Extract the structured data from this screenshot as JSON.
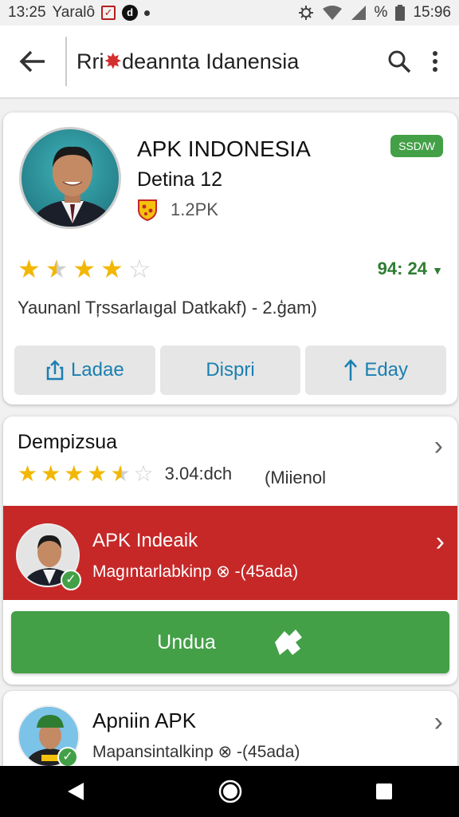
{
  "status_bar": {
    "time_left": "13:25",
    "left_text": "Yaralô",
    "time_right": "15:96",
    "percent": "%"
  },
  "app_bar": {
    "title_pre": "Rri",
    "title_post": "deannta Idanensia"
  },
  "app_card": {
    "name": "APK INDONESIA",
    "subtitle": "Detina 12",
    "badge": "SSD/W",
    "size": "1.2PK",
    "rating_stars": 3.5,
    "score": "94: 24",
    "description": "Yaunanl Tŗssarlaıgal Datkakf) - 2.ģam)",
    "buttons": [
      {
        "label": "Ladae",
        "icon": "share-icon"
      },
      {
        "label": "Dispri",
        "icon": ""
      },
      {
        "label": "Eday",
        "icon": "upload-arrow-icon"
      }
    ]
  },
  "section": {
    "title": "Dempizsua",
    "rating_stars": 4.5,
    "rating_value": "3.04:dch",
    "rating_note": "(Miienol"
  },
  "featured": {
    "title": "APK Indeaik",
    "subtitle": "Magıntarlabkinp ⊗ -(45ada)"
  },
  "download_button": {
    "label": "Undua"
  },
  "list_item": {
    "title": "Apniin APK",
    "subtitle": "Mapansintalkinp ⊗ -(45ada)"
  },
  "colors": {
    "accent_green": "#43a047",
    "accent_red": "#c62828",
    "link_blue": "#1a7fb0",
    "star_gold": "#f2b705"
  }
}
